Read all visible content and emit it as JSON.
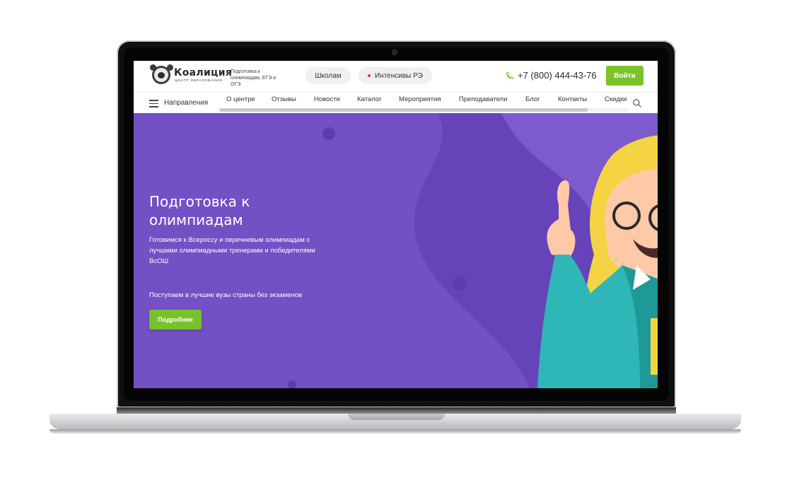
{
  "brand": {
    "name": "Коалиция",
    "subtitle": "ЦЕНТР ОБРАЗОВАНИЯ",
    "tagline": "Подготовка к олимпиадам, ЕГЭ и ОГЭ"
  },
  "header": {
    "pill_schools": "Школам",
    "pill_intensives": "Интенсивы РЭ",
    "phone": "+7 (800) 444-43-76",
    "login_label": "Войти"
  },
  "nav": {
    "directions_label": "Направления",
    "items": [
      "О центре",
      "Отзывы",
      "Новости",
      "Каталог",
      "Мероприятия",
      "Преподаватели",
      "Блог",
      "Контакты",
      "Скидки"
    ]
  },
  "hero": {
    "title": "Подготовка к олимпиадам",
    "description": "Готовимся к Всероссу и перечневым олимпиадам с лучшими олимпиадными тренерами и победителями ВсОШ",
    "subtext": "Поступаем в лучшие вузы страны без экзаменов",
    "button_label": "Подробнее"
  },
  "colors": {
    "accent_green": "#7ac32b",
    "hero_purple": "#7350c3",
    "alert_red": "#e53935"
  },
  "icons": {
    "menu": "hamburger-menu-icon",
    "phone": "phone-icon",
    "search": "search-icon",
    "logo": "koala-logo-icon"
  }
}
